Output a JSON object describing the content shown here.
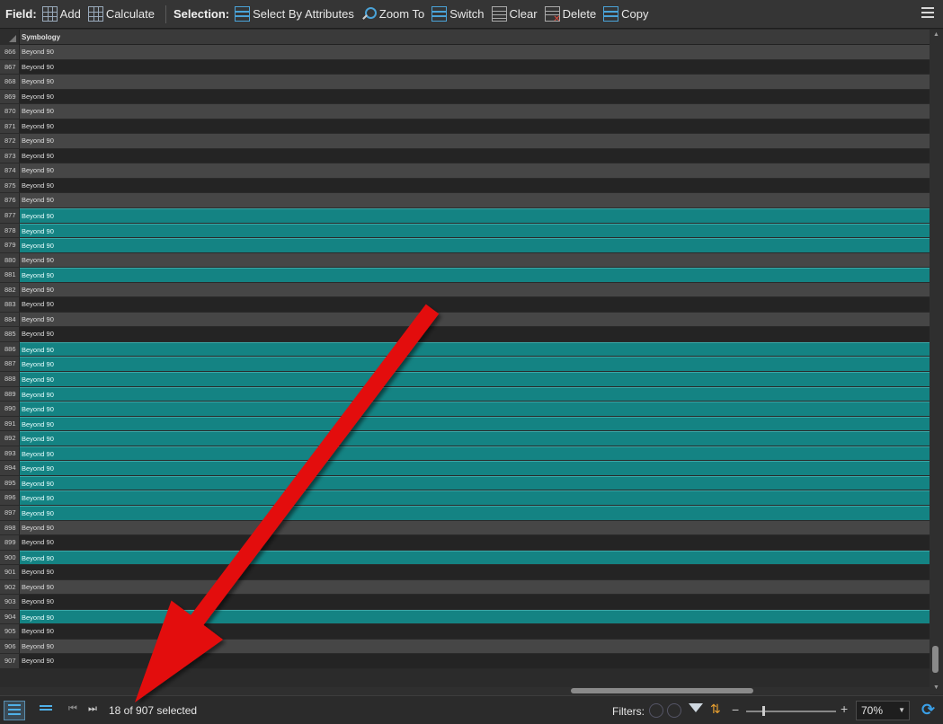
{
  "toolbar": {
    "field_label": "Field:",
    "add_label": "Add",
    "calculate_label": "Calculate",
    "selection_label": "Selection:",
    "select_by_attributes_label": "Select By Attributes",
    "zoom_to_label": "Zoom To",
    "switch_label": "Switch",
    "clear_label": "Clear",
    "delete_label": "Delete",
    "copy_label": "Copy"
  },
  "table": {
    "column_header": "Symbology",
    "rows": [
      {
        "n": "866",
        "v": "Beyond 90",
        "selected": false
      },
      {
        "n": "867",
        "v": "Beyond 90",
        "selected": false
      },
      {
        "n": "868",
        "v": "Beyond 90",
        "selected": false
      },
      {
        "n": "869",
        "v": "Beyond 90",
        "selected": false
      },
      {
        "n": "870",
        "v": "Beyond 90",
        "selected": false
      },
      {
        "n": "871",
        "v": "Beyond 90",
        "selected": false
      },
      {
        "n": "872",
        "v": "Beyond 90",
        "selected": false
      },
      {
        "n": "873",
        "v": "Beyond 90",
        "selected": false
      },
      {
        "n": "874",
        "v": "Beyond 90",
        "selected": false
      },
      {
        "n": "875",
        "v": "Beyond 90",
        "selected": false
      },
      {
        "n": "876",
        "v": "Beyond 90",
        "selected": false
      },
      {
        "n": "877",
        "v": "Beyond 90",
        "selected": true
      },
      {
        "n": "878",
        "v": "Beyond 90",
        "selected": true
      },
      {
        "n": "879",
        "v": "Beyond 90",
        "selected": true
      },
      {
        "n": "880",
        "v": "Beyond 90",
        "selected": false
      },
      {
        "n": "881",
        "v": "Beyond 90",
        "selected": true
      },
      {
        "n": "882",
        "v": "Beyond 90",
        "selected": false
      },
      {
        "n": "883",
        "v": "Beyond 90",
        "selected": false
      },
      {
        "n": "884",
        "v": "Beyond 90",
        "selected": false
      },
      {
        "n": "885",
        "v": "Beyond 90",
        "selected": false
      },
      {
        "n": "886",
        "v": "Beyond 90",
        "selected": true
      },
      {
        "n": "887",
        "v": "Beyond 90",
        "selected": true
      },
      {
        "n": "888",
        "v": "Beyond 90",
        "selected": true
      },
      {
        "n": "889",
        "v": "Beyond 90",
        "selected": true
      },
      {
        "n": "890",
        "v": "Beyond 90",
        "selected": true
      },
      {
        "n": "891",
        "v": "Beyond 90",
        "selected": true
      },
      {
        "n": "892",
        "v": "Beyond 90",
        "selected": true
      },
      {
        "n": "893",
        "v": "Beyond 90",
        "selected": true
      },
      {
        "n": "894",
        "v": "Beyond 90",
        "selected": true
      },
      {
        "n": "895",
        "v": "Beyond 90",
        "selected": true
      },
      {
        "n": "896",
        "v": "Beyond 90",
        "selected": true
      },
      {
        "n": "897",
        "v": "Beyond 90",
        "selected": true
      },
      {
        "n": "898",
        "v": "Beyond 90",
        "selected": false
      },
      {
        "n": "899",
        "v": "Beyond 90",
        "selected": false
      },
      {
        "n": "900",
        "v": "Beyond 90",
        "selected": true
      },
      {
        "n": "901",
        "v": "Beyond 90",
        "selected": false
      },
      {
        "n": "902",
        "v": "Beyond 90",
        "selected": false
      },
      {
        "n": "903",
        "v": "Beyond 90",
        "selected": false
      },
      {
        "n": "904",
        "v": "Beyond 90",
        "selected": true
      },
      {
        "n": "905",
        "v": "Beyond 90",
        "selected": false
      },
      {
        "n": "906",
        "v": "Beyond 90",
        "selected": false
      },
      {
        "n": "907",
        "v": "Beyond 90",
        "selected": false
      }
    ]
  },
  "status": {
    "selection_count": "18 of 907 selected",
    "filters_label": "Filters:",
    "zoom_level": "70%"
  },
  "icons": {
    "add": "add-field-icon",
    "calculate": "calculate-icon",
    "select_by_attributes": "select-by-attributes-icon",
    "zoom_to": "zoom-to-icon",
    "switch": "switch-selection-icon",
    "clear": "clear-selection-icon",
    "delete": "delete-icon",
    "copy": "copy-icon",
    "menu": "hamburger-menu-icon",
    "refresh": "refresh-icon"
  },
  "colors": {
    "selected_row": "#148383",
    "annotation_arrow": "#e30b0b",
    "accent": "#4fb0e8"
  }
}
